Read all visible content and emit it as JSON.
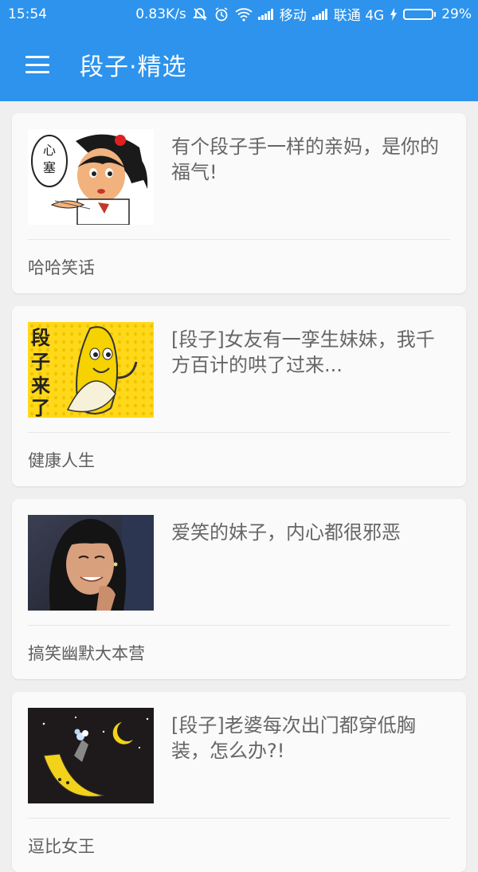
{
  "status_bar": {
    "time": "15:54",
    "net_speed": "0.83K/s",
    "carrier_1": "移动",
    "carrier_2": "联通 4G",
    "battery_percent": "29%",
    "battery_level": 0.29
  },
  "toolbar": {
    "title": "段子·精选",
    "menu_icon": "hamburger-menu-icon"
  },
  "colors": {
    "primary": "#2d93ec",
    "card_bg": "#fafafa",
    "page_bg": "#efefef",
    "title_text": "#666666",
    "battery_green": "#5ad15a"
  },
  "cards": [
    {
      "title": "有个段子手一样的亲妈，是你的福气!",
      "source": "哈哈笑话",
      "thumb": "cartoon-girl-thumbnail"
    },
    {
      "title": "[段子]女友有一孪生妹妹，我千方百计的哄了过来...",
      "source": "健康人生",
      "thumb": "banana-cartoon-thumbnail"
    },
    {
      "title": "爱笑的妹子，内心都很邪恶",
      "source": "搞笑幽默大本营",
      "thumb": "smiling-woman-thumbnail"
    },
    {
      "title": "[段子]老婆每次出门都穿低胸装，怎么办?!",
      "source": "逗比女王",
      "thumb": "banana-moon-thumbnail"
    }
  ],
  "thumb_text": {
    "card1": "心塞",
    "card2": "段子来了"
  }
}
